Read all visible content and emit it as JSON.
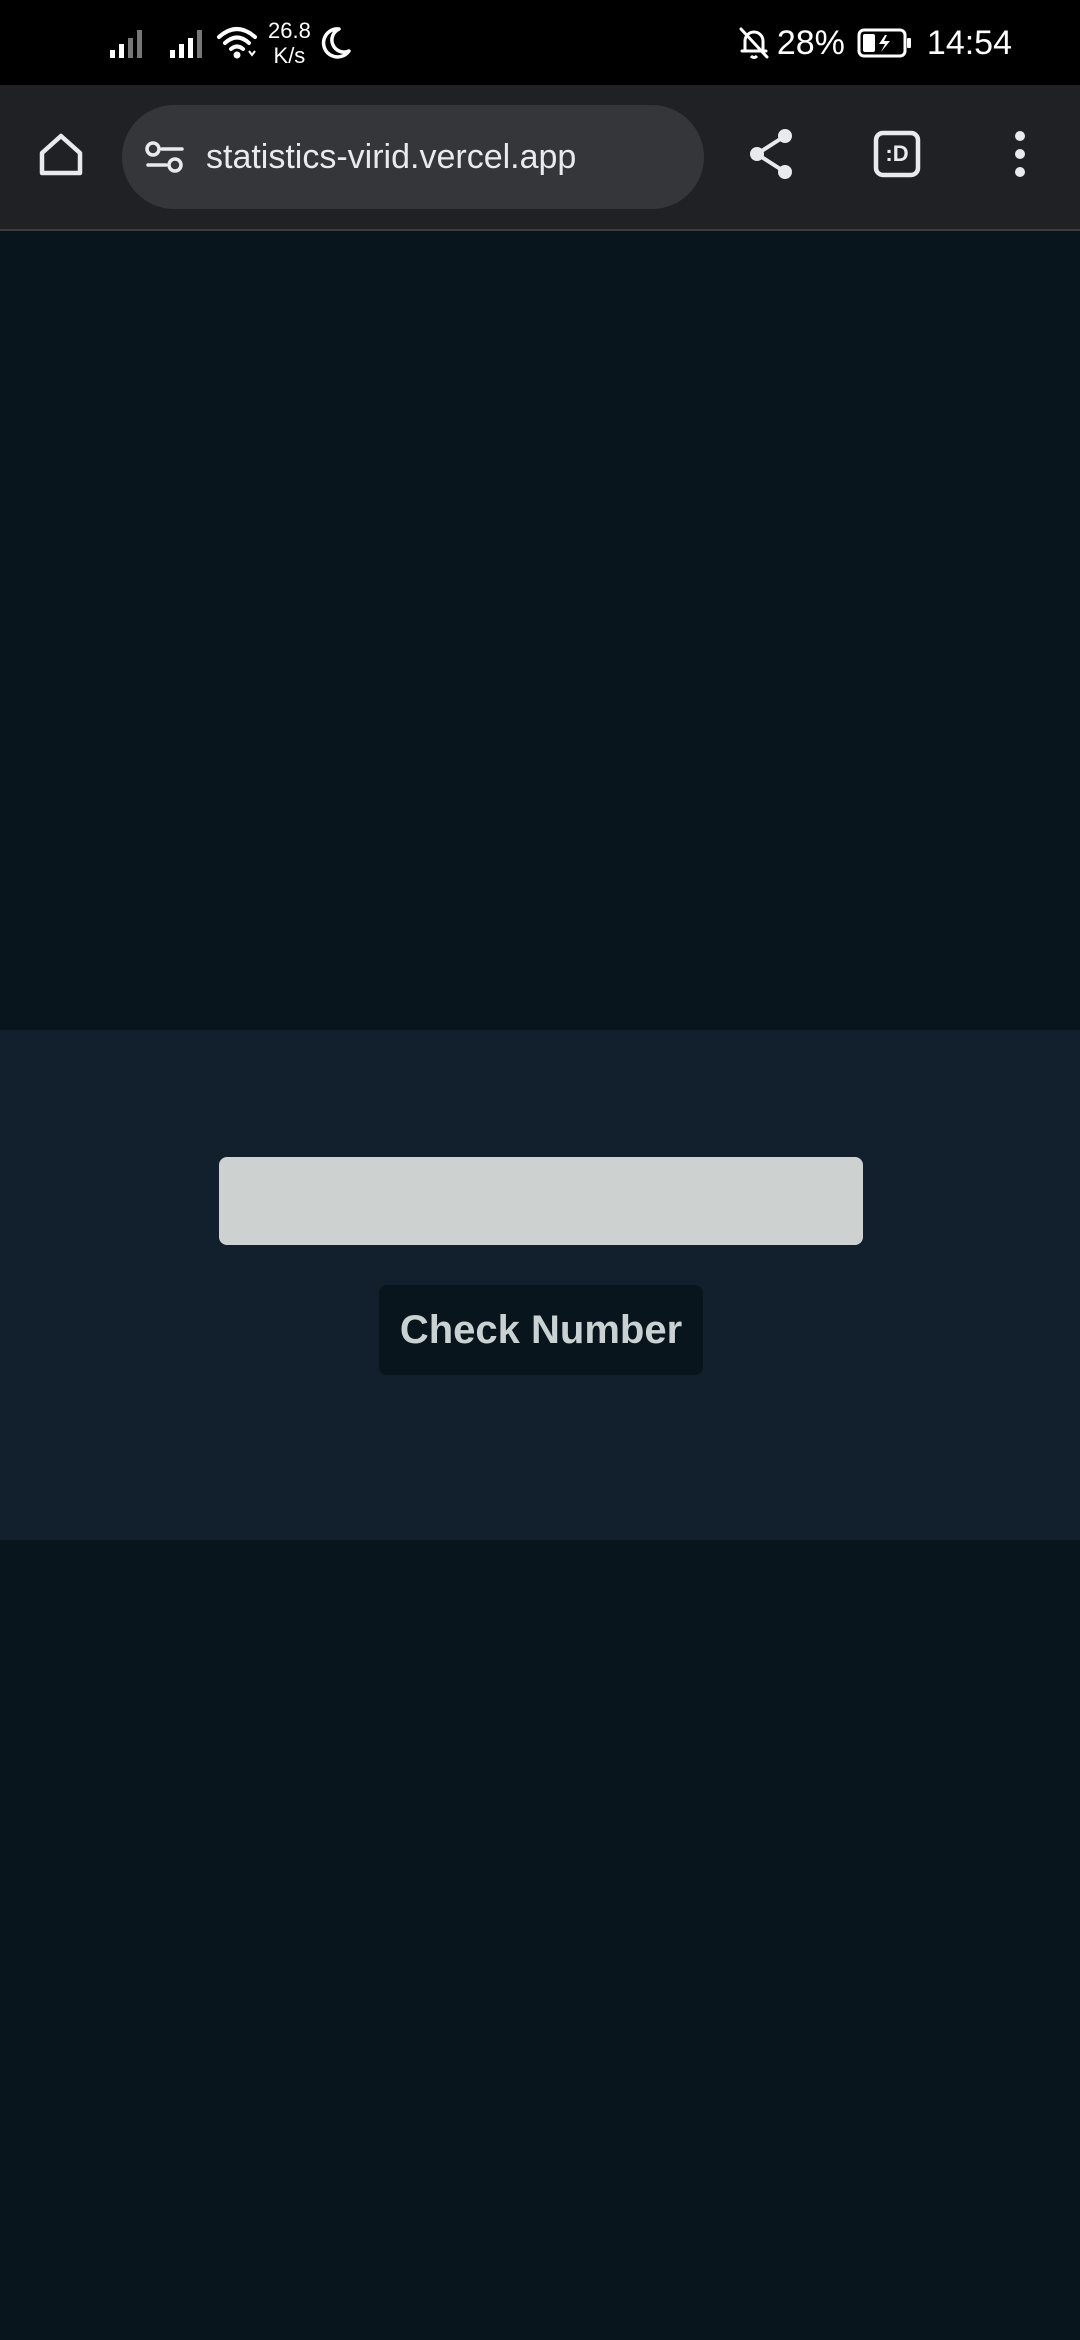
{
  "status_bar": {
    "net_speed_value": "26.8",
    "net_speed_unit": "K/s",
    "battery_percent": "28%",
    "time": "14:54",
    "icons": [
      "signal-icon",
      "signal-icon",
      "wifi-icon",
      "moon-icon",
      "bell-off-icon",
      "battery-charging-icon"
    ]
  },
  "browser": {
    "url": "statistics-virid.vercel.app",
    "tab_switcher_label": ":D",
    "icons": [
      "home-icon",
      "tune-icon",
      "share-icon",
      "tab-switcher-icon",
      "more-vert-icon"
    ]
  },
  "form": {
    "input_value": "",
    "input_placeholder": "",
    "button_label": "Check Number"
  },
  "colors": {
    "page_background": "#08151c",
    "panel_background": "#121f2d",
    "input_background": "#cdd2d1",
    "button_background": "#08151c",
    "button_text": "#c9d1d3"
  }
}
